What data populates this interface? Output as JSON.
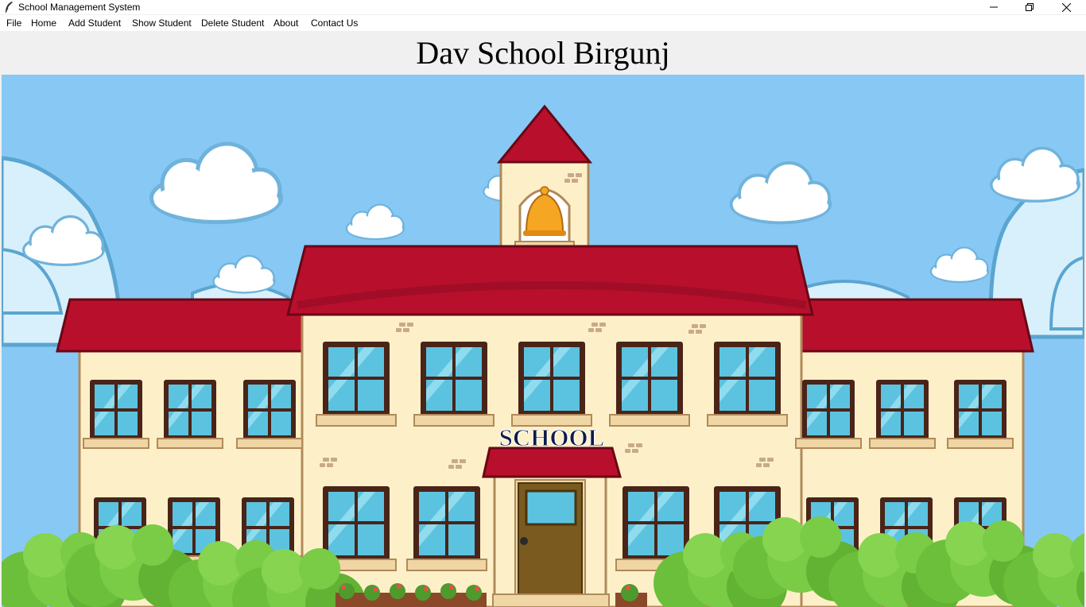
{
  "window": {
    "title": "School Management System",
    "icon": "feather-icon",
    "controls": [
      "minimize-icon",
      "restore-icon",
      "close-icon"
    ]
  },
  "menu": {
    "items": [
      {
        "label": "File"
      },
      {
        "label": "Home"
      },
      {
        "label": "Add Student"
      },
      {
        "label": "Show Student"
      },
      {
        "label": "Delete Student"
      },
      {
        "label": "About"
      },
      {
        "label": "Contact Us"
      }
    ]
  },
  "header": {
    "title": "Dav School Birgunj"
  },
  "illustration": {
    "sign_text": "SCHOOL",
    "colors": {
      "sky": "#87c9f4",
      "roof": "#b8102c",
      "wall": "#fdf0c8",
      "window_glass": "#5bc3e0",
      "window_frame": "#4a2418",
      "bush": "#6cbf3a",
      "door": "#7a5a1e",
      "bell": "#f5a623"
    }
  }
}
